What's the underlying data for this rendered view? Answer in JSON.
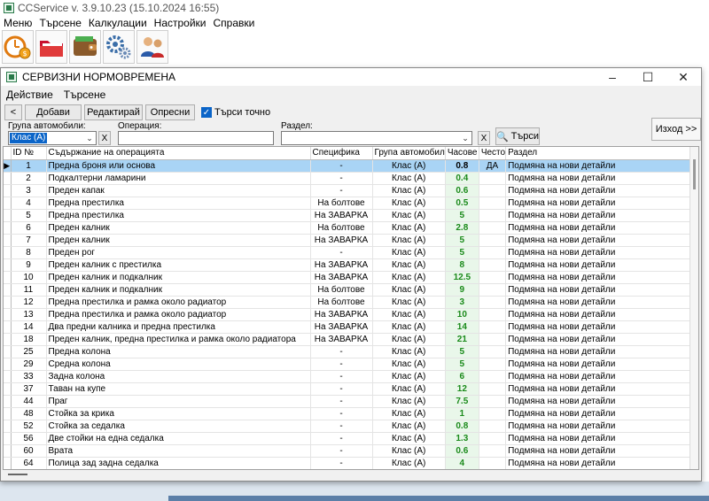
{
  "app": {
    "title": "CCService v. 3.9.10.23 (15.10.2024 16:55)",
    "menu": [
      "Меню",
      "Търсене",
      "Калкулации",
      "Настройки",
      "Справки"
    ],
    "toolbar_icons": [
      "clock-money-icon",
      "folder-icon",
      "wallet-icon",
      "gears-icon",
      "users-icon"
    ]
  },
  "dialog": {
    "title": "СЕРВИЗНИ НОРМОВРЕМЕНА",
    "menu": [
      "Действие",
      "Търсене"
    ],
    "buttons": {
      "back": "<",
      "add": "Добави",
      "edit": "Редактирай",
      "refresh": "Опресни"
    },
    "exact_search_label": "Търси точно",
    "exact_search_checked": true,
    "filters": {
      "group_label": "Група автомобили:",
      "group_value": "Клас (А)",
      "operation_label": "Операция:",
      "operation_value": "",
      "section_label": "Раздел:",
      "section_value": "",
      "clear": "X",
      "search_button": "Търси",
      "exit_button": "Изход >>"
    },
    "columns": [
      "ID №",
      "Съдържание на операцията",
      "Специфика",
      "Група автомобил",
      "Часове",
      "Често",
      "Раздел"
    ],
    "rows": [
      [
        "1",
        "Предна броня или основа",
        "-",
        "Клас (А)",
        "0.8",
        "ДА",
        "Подмяна на нови детайли"
      ],
      [
        "2",
        "Подкалтерни ламарини",
        "-",
        "Клас (А)",
        "0.4",
        "",
        "Подмяна на нови детайли"
      ],
      [
        "3",
        "Преден капак",
        "-",
        "Клас (А)",
        "0.6",
        "",
        "Подмяна на нови детайли"
      ],
      [
        "4",
        "Предна престилка",
        "На болтове",
        "Клас (А)",
        "0.5",
        "",
        "Подмяна на нови детайли"
      ],
      [
        "5",
        "Предна престилка",
        "На ЗАВАРКА",
        "Клас (А)",
        "5",
        "",
        "Подмяна на нови детайли"
      ],
      [
        "6",
        "Преден калник",
        "На болтове",
        "Клас (А)",
        "2.8",
        "",
        "Подмяна на нови детайли"
      ],
      [
        "7",
        "Преден калник",
        "На ЗАВАРКА",
        "Клас (А)",
        "5",
        "",
        "Подмяна на нови детайли"
      ],
      [
        "8",
        "Преден рог",
        "-",
        "Клас (А)",
        "5",
        "",
        "Подмяна на нови детайли"
      ],
      [
        "9",
        "Преден калник с престилка",
        "На ЗАВАРКА",
        "Клас (А)",
        "8",
        "",
        "Подмяна на нови детайли"
      ],
      [
        "10",
        "Преден калник и подкалник",
        "На ЗАВАРКА",
        "Клас (А)",
        "12.5",
        "",
        "Подмяна на нови детайли"
      ],
      [
        "11",
        "Преден калник и подкалник",
        "На болтове",
        "Клас (А)",
        "9",
        "",
        "Подмяна на нови детайли"
      ],
      [
        "12",
        "Предна престилка и рамка около радиатор",
        "На болтове",
        "Клас (А)",
        "3",
        "",
        "Подмяна на нови детайли"
      ],
      [
        "13",
        "Предна престилка и рамка около радиатор",
        "На ЗАВАРКА",
        "Клас (А)",
        "10",
        "",
        "Подмяна на нови детайли"
      ],
      [
        "14",
        "Два предни калника и предна престилка",
        "На ЗАВАРКА",
        "Клас (А)",
        "14",
        "",
        "Подмяна на нови детайли"
      ],
      [
        "18",
        "Преден калник, предна престилка и рамка около радиатора",
        "На ЗАВАРКА",
        "Клас (А)",
        "21",
        "",
        "Подмяна на нови детайли"
      ],
      [
        "25",
        "Предна колона",
        "-",
        "Клас (А)",
        "5",
        "",
        "Подмяна на нови детайли"
      ],
      [
        "29",
        "Средна колона",
        "-",
        "Клас (А)",
        "5",
        "",
        "Подмяна на нови детайли"
      ],
      [
        "33",
        "Задна колона",
        "-",
        "Клас (А)",
        "6",
        "",
        "Подмяна на нови детайли"
      ],
      [
        "37",
        "Таван на купе",
        "-",
        "Клас (А)",
        "12",
        "",
        "Подмяна на нови детайли"
      ],
      [
        "44",
        "Праг",
        "-",
        "Клас (А)",
        "7.5",
        "",
        "Подмяна на нови детайли"
      ],
      [
        "48",
        "Стойка за крика",
        "-",
        "Клас (А)",
        "1",
        "",
        "Подмяна на нови детайли"
      ],
      [
        "52",
        "Стойка за седалка",
        "-",
        "Клас (А)",
        "0.8",
        "",
        "Подмяна на нови детайли"
      ],
      [
        "56",
        "Две стойки на една седалка",
        "-",
        "Клас (А)",
        "1.3",
        "",
        "Подмяна на нови детайли"
      ],
      [
        "60",
        "Врата",
        "-",
        "Клас (А)",
        "0.6",
        "",
        "Подмяна на нови детайли"
      ],
      [
        "64",
        "Полица зад задна седалка",
        "-",
        "Клас (А)",
        "4",
        "",
        "Подмяна на нови детайли"
      ]
    ],
    "selected_row_index": 0
  },
  "colors": {
    "selection": "#a9d4f5",
    "hours_bg": "#e9f7ea",
    "hours_fg": "#1b8a1b",
    "accent": "#0a64c8"
  }
}
